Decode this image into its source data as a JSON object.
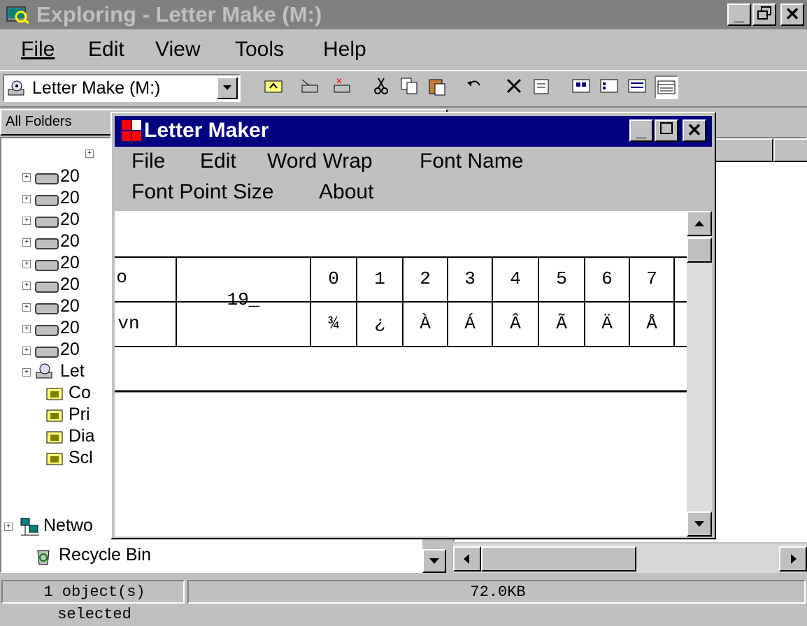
{
  "explorer": {
    "title": "Exploring - Letter Make (M:)",
    "menu": [
      "File",
      "Edit",
      "View",
      "Tools",
      "Help"
    ],
    "address": "Letter Make (M:)",
    "all_folders_label": "All Folders",
    "tree": [
      {
        "label": "20",
        "type": "drive"
      },
      {
        "label": "20",
        "type": "drive"
      },
      {
        "label": "20",
        "type": "drive"
      },
      {
        "label": "20",
        "type": "drive"
      },
      {
        "label": "20",
        "type": "drive"
      },
      {
        "label": "20",
        "type": "drive"
      },
      {
        "label": "20",
        "type": "drive"
      },
      {
        "label": "20",
        "type": "drive"
      },
      {
        "label": "20",
        "type": "drive"
      },
      {
        "label": "Let",
        "type": "cd"
      },
      {
        "label": "Co",
        "type": "folder"
      },
      {
        "label": "Pri",
        "type": "folder"
      },
      {
        "label": "Dia",
        "type": "folder"
      },
      {
        "label": "Scl",
        "type": "folder"
      }
    ],
    "network_label": "Netwo",
    "recycle_label": "Recycle Bin",
    "status": {
      "objects": "1 object(s) selected",
      "size": "72.0KB"
    }
  },
  "letter_maker": {
    "title": "Letter Maker",
    "menu_row1": [
      "File",
      "Edit",
      "Word Wrap",
      "Font Name"
    ],
    "menu_row2": [
      "Font Point Size",
      "About"
    ],
    "left_cell_top": "o",
    "left_cell_bottom": "vn",
    "code_value": "19_",
    "digits": [
      "0",
      "1",
      "2",
      "3",
      "4",
      "5",
      "6",
      "7"
    ],
    "chars": [
      "¾",
      "¿",
      "À",
      "Á",
      "Â",
      "Ã",
      "Ä",
      "Å"
    ]
  },
  "colors": {
    "titlebar_active": "#000080",
    "titlebar_inactive": "#808080",
    "face": "#c0c0c0"
  }
}
